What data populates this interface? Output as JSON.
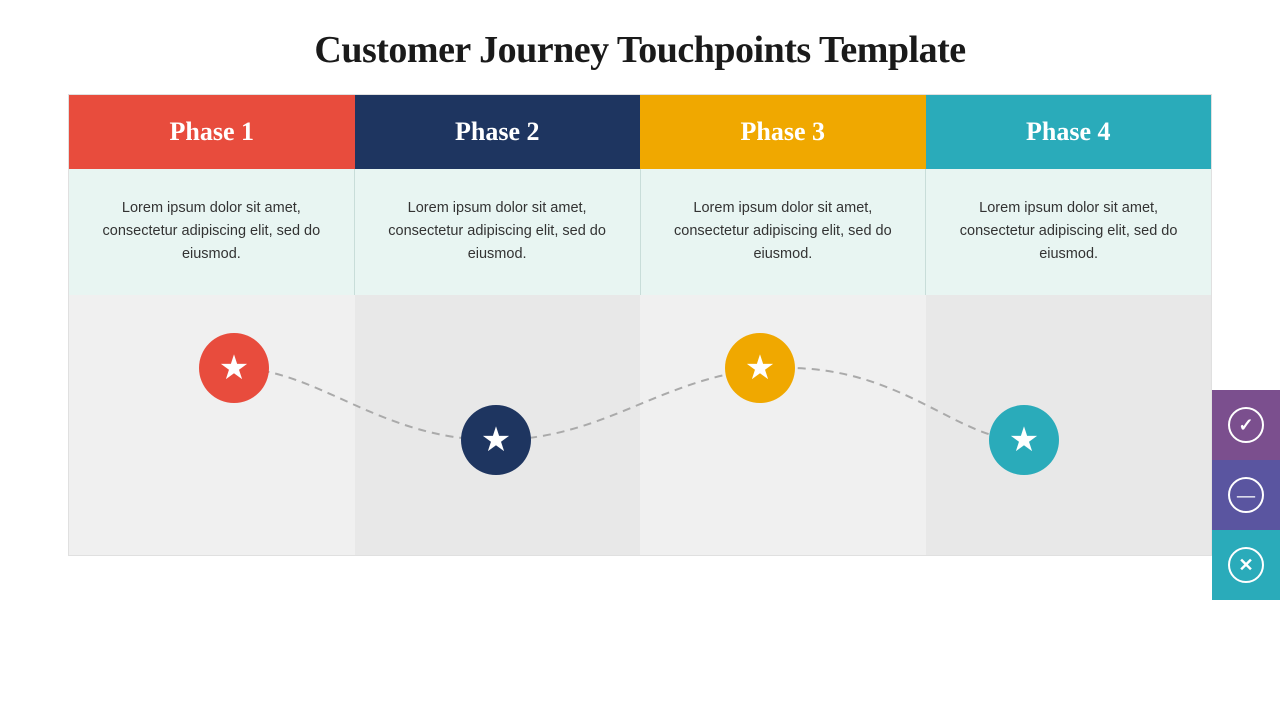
{
  "title": "Customer Journey Touchpoints Template",
  "phases": [
    {
      "id": "phase1",
      "label": "Phase 1",
      "colorClass": "phase1"
    },
    {
      "id": "phase2",
      "label": "Phase 2",
      "colorClass": "phase2"
    },
    {
      "id": "phase3",
      "label": "Phase 3",
      "colorClass": "phase3"
    },
    {
      "id": "phase4",
      "label": "Phase 4",
      "colorClass": "phase4"
    }
  ],
  "content": [
    {
      "text": "Lorem ipsum dolor sit amet, consectetur adipiscing elit, sed do eiusmod."
    },
    {
      "text": "Lorem ipsum dolor sit amet, consectetur adipiscing elit, sed do eiusmod."
    },
    {
      "text": "Lorem ipsum dolor sit amet, consectetur adipiscing elit, sed do eiusmod."
    },
    {
      "text": "Lorem ipsum dolor sit amet, consectetur adipiscing elit, sed do eiusmod."
    }
  ],
  "buttons": [
    {
      "id": "check",
      "icon": "✓",
      "colorClass": "btn-check"
    },
    {
      "id": "minus",
      "icon": "—",
      "colorClass": "btn-minus"
    },
    {
      "id": "close",
      "icon": "✕",
      "colorClass": "btn-close"
    }
  ],
  "starSymbol": "★"
}
